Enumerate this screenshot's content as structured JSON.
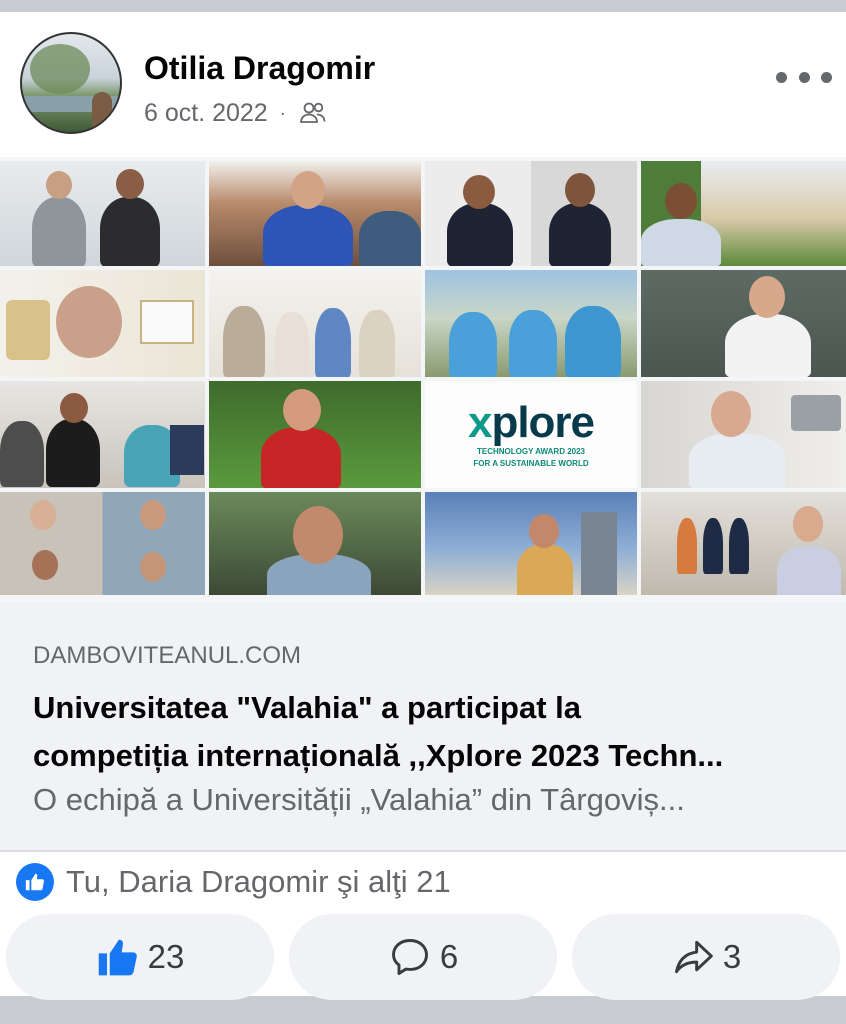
{
  "post": {
    "author": "Otilia Dragomir",
    "date": "6 oct. 2022",
    "separator": "·",
    "audience_icon": "friends-icon",
    "more_icon": "more-options-icon"
  },
  "link_preview": {
    "domain": "DAMBOVITEANUL.COM",
    "title_line1": "Universitatea \"Valahia\" a participat la",
    "title_line2": "competiția internațională ,,Xplore 2023 Techn...",
    "description": "O echipă a Universității „Valahia” din Târgoviș...",
    "image": {
      "logo_x": "x",
      "logo_rest": "plore",
      "logo_tagline_1": "TECHNOLOGY AWARD 2023",
      "logo_tagline_2": "FOR A SUSTAINABLE WORLD"
    }
  },
  "reactions": {
    "icon": "like-icon",
    "summary": "Tu, Daria Dragomir şi alţi 21"
  },
  "actions": {
    "like_count": "23",
    "comment_count": "6",
    "share_count": "3"
  },
  "colors": {
    "accent": "#1877f2",
    "secondary_text": "#65676b",
    "link_box_bg": "#f0f2f5",
    "xplore_dark": "#073b4c",
    "xplore_teal": "#0d9a8a"
  }
}
